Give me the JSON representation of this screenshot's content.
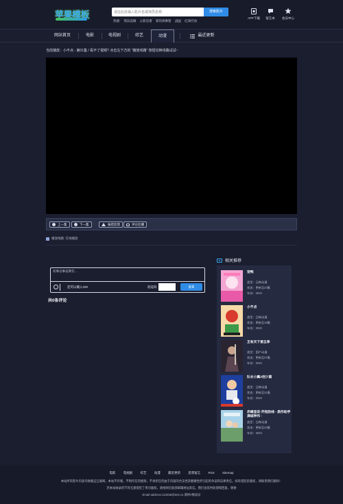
{
  "header": {
    "logo_text": "苹果模板",
    "search_placeholder": "请在此处输入影片名或演员名称",
    "search_button": "搜索影片",
    "hot_label": "热搜:",
    "hot_items": [
      "惊异追眼",
      "火影忍者",
      "新的调事管",
      "战国",
      "红海行动"
    ],
    "icons": [
      {
        "icon": "app-icon",
        "label": "APP下载"
      },
      {
        "icon": "message-icon",
        "label": "留言本"
      },
      {
        "icon": "star-icon",
        "label": "会员中心"
      }
    ]
  },
  "nav": {
    "items": [
      "网站首页",
      "电影",
      "电视剧",
      "综艺",
      "动漫"
    ],
    "active": "动漫",
    "recent": "最近更新"
  },
  "breadcrumb": "当前播放：小不点 - 第01集 / 看不了视频? 点击左下方的 \"播放线路\" 按钮切换线路试试~",
  "controls": {
    "prev": "上一集",
    "next": "下一集",
    "report": "报错反馈",
    "comment": "评论吐槽"
  },
  "source": "播放线路: 在线播放",
  "comment": {
    "placeholder": "有事没事说两句...",
    "remaining": "还可以输入200",
    "verify_label": "验证码",
    "publish": "发布",
    "count": "共0条评论"
  },
  "related": {
    "title": "相关推荐",
    "items": [
      {
        "name": "宠鸭",
        "type": "类型：日韩动漫",
        "status": "状态：更新至24集",
        "year": "年份：2024",
        "color": "#e85aa8"
      },
      {
        "name": "小不点",
        "type": "类型：日韩动漫",
        "status": "状态：更新至16集",
        "year": "年份：2023",
        "color": "#d83a2e"
      },
      {
        "name": "王有天下第五季",
        "type": "类型：国产动漫",
        "status": "状态：更新至07集",
        "year": "年份：2024",
        "color": "#3b3040"
      },
      {
        "name": "队长小翼2创少篇",
        "type": "类型：日韩动漫",
        "status": "状态：更新至21集",
        "year": "年份：2023",
        "color": "#2b5bd8"
      },
      {
        "name": "赤蜻竖说-开拓防线 - 质作助手满城神作 -",
        "type": "类型：日韩动漫",
        "status": "状态：更新至20集",
        "year": "年份：2023",
        "color": "#6fa8c8"
      }
    ]
  },
  "footer": {
    "links": [
      "电影",
      "电视剧",
      "综艺",
      "动漫",
      "最近更新",
      "反馈留言",
      "RSS",
      "Sitemap"
    ],
    "line1": "本站所有影片内容均收集自互联网，本站不存储，不制作任何视频，不承担任何由于内容的合法性及健康性所引起的争议和法律责任。如有侵犯您版权，请联系我们删除！",
    "line2": "若本站收录的节目无意侵犯了贵司版权，请给网页底部邮箱地址来信，我们会及时处理和回复，谢谢",
    "line3": "Email address:123456@test.cn,请将#换成@"
  }
}
